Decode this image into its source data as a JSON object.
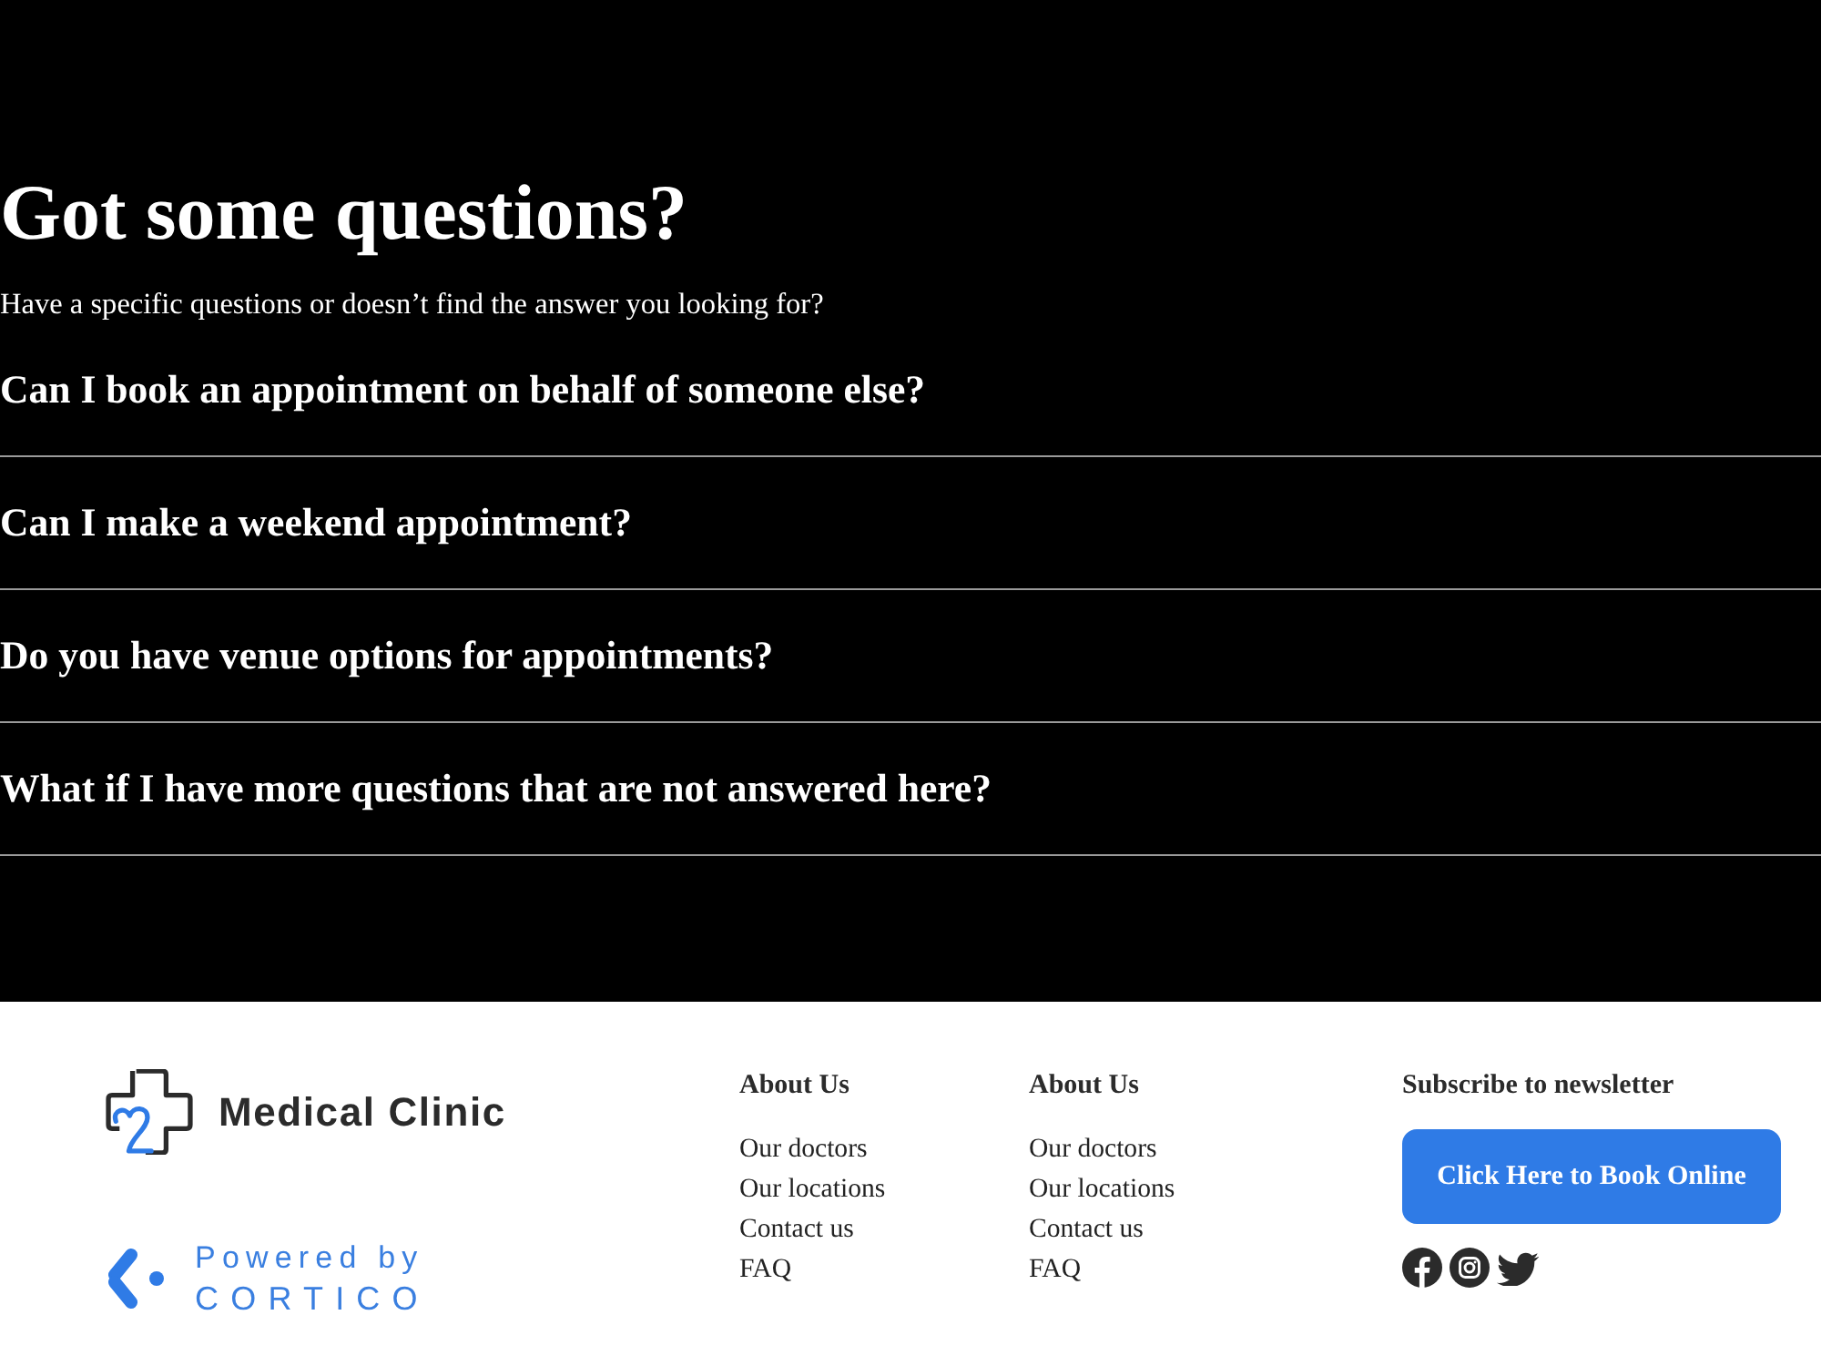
{
  "faq": {
    "title": "Got some questions?",
    "subtitle": "Have a specific questions or doesn’t find the answer you looking for?",
    "questions": [
      {
        "question": "Can I book an appointment on behalf of someone else?"
      },
      {
        "question": "Can I make a weekend appointment?"
      },
      {
        "question": "Do you have venue options for appointments?"
      },
      {
        "question": "What if I have more questions that are not answered here?"
      }
    ]
  },
  "footer": {
    "brand": {
      "name": "Medical Clinic"
    },
    "powered_by": {
      "label": "Powered by",
      "name": "CORTICO"
    },
    "columns": [
      {
        "heading": "About Us",
        "links": [
          "Our doctors",
          "Our locations",
          "Contact us",
          "FAQ"
        ]
      },
      {
        "heading": "About Us",
        "links": [
          "Our doctors",
          "Our locations",
          "Contact us",
          "FAQ"
        ]
      }
    ],
    "newsletter": {
      "heading": "Subscribe to newsletter",
      "button": "Click Here to Book Online"
    }
  }
}
